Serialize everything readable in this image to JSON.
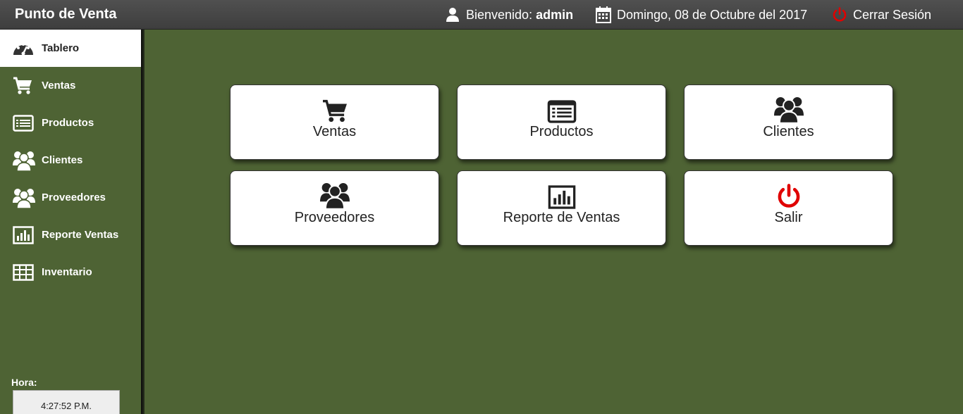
{
  "app": {
    "title": "Punto de Venta"
  },
  "header": {
    "welcome_label": "Bienvenido:",
    "user": "admin",
    "date": "Domingo, 08 de Octubre del 2017",
    "logout_label": "Cerrar Sesión"
  },
  "sidebar": {
    "items": [
      {
        "label": "Tablero",
        "icon": "dashboard-icon",
        "active": true
      },
      {
        "label": "Ventas",
        "icon": "cart-icon"
      },
      {
        "label": "Productos",
        "icon": "list-icon"
      },
      {
        "label": "Clientes",
        "icon": "users-icon"
      },
      {
        "label": "Proveedores",
        "icon": "users-icon"
      },
      {
        "label": "Reporte Ventas",
        "icon": "bar-chart-icon"
      },
      {
        "label": "Inventario",
        "icon": "table-icon"
      }
    ],
    "time_label": "Hora:",
    "time_value": "4:27:52 P.M."
  },
  "tiles": [
    {
      "label": "Ventas",
      "icon": "cart-icon"
    },
    {
      "label": "Productos",
      "icon": "list-icon"
    },
    {
      "label": "Clientes",
      "icon": "users-icon"
    },
    {
      "label": "Proveedores",
      "icon": "users-icon"
    },
    {
      "label": "Reporte de Ventas",
      "icon": "bar-chart-icon"
    },
    {
      "label": "Salir",
      "icon": "power-icon"
    }
  ],
  "colors": {
    "background": "#4e6334",
    "topbar": "#464646",
    "power": "#e00000"
  }
}
